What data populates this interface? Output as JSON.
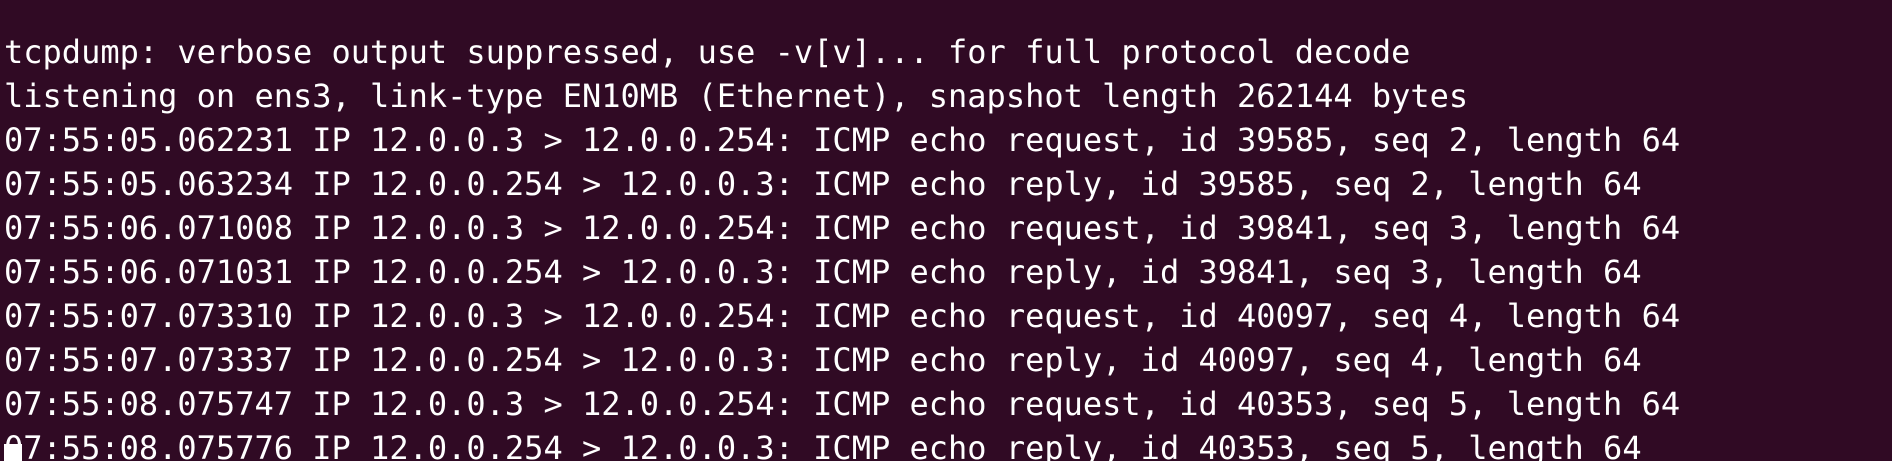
{
  "terminal": {
    "partial_top_line": "                                              ",
    "lines": [
      "tcpdump: verbose output suppressed, use -v[v]... for full protocol decode",
      "listening on ens3, link-type EN10MB (Ethernet), snapshot length 262144 bytes",
      "07:55:05.062231 IP 12.0.0.3 > 12.0.0.254: ICMP echo request, id 39585, seq 2, length 64",
      "07:55:05.063234 IP 12.0.0.254 > 12.0.0.3: ICMP echo reply, id 39585, seq 2, length 64",
      "07:55:06.071008 IP 12.0.0.3 > 12.0.0.254: ICMP echo request, id 39841, seq 3, length 64",
      "07:55:06.071031 IP 12.0.0.254 > 12.0.0.3: ICMP echo reply, id 39841, seq 3, length 64",
      "07:55:07.073310 IP 12.0.0.3 > 12.0.0.254: ICMP echo request, id 40097, seq 4, length 64",
      "07:55:07.073337 IP 12.0.0.254 > 12.0.0.3: ICMP echo reply, id 40097, seq 4, length 64",
      "07:55:08.075747 IP 12.0.0.3 > 12.0.0.254: ICMP echo request, id 40353, seq 5, length 64",
      "07:55:08.075776 IP 12.0.0.254 > 12.0.0.3: ICMP echo reply, id 40353, seq 5, length 64"
    ],
    "background_color": "#300a24",
    "text_color": "#ffffff"
  }
}
